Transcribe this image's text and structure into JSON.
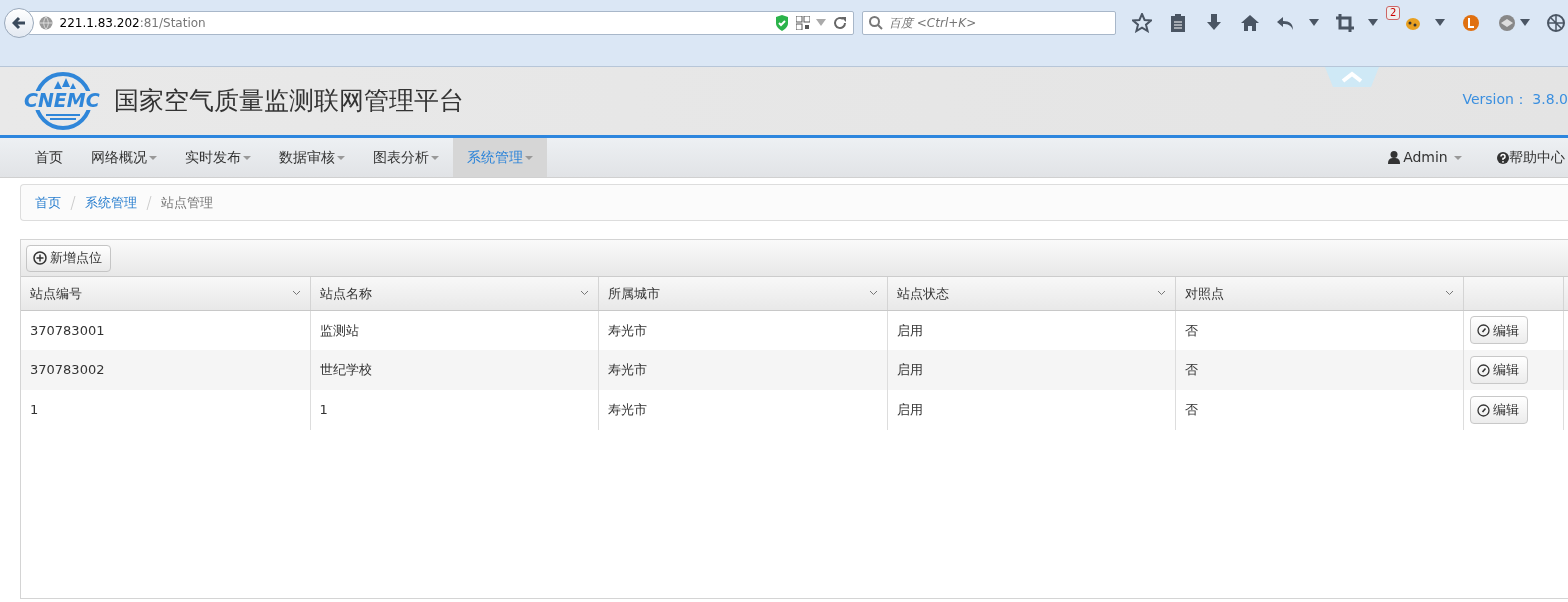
{
  "browser": {
    "url_host": "221.1.83.202",
    "url_rest": ":81/Station",
    "search": {
      "placeholder": "百度 <Ctrl+K>"
    },
    "badge": "2"
  },
  "header": {
    "logo_text": "CNEMC",
    "title": "国家空气质量监测联网管理平台",
    "version": "Version： 3.8.0"
  },
  "nav": {
    "items": [
      {
        "label": "首页",
        "dropdown": false,
        "selected": false
      },
      {
        "label": "网络概况",
        "dropdown": true,
        "selected": false
      },
      {
        "label": "实时发布",
        "dropdown": true,
        "selected": false
      },
      {
        "label": "数据审核",
        "dropdown": true,
        "selected": false
      },
      {
        "label": "图表分析",
        "dropdown": true,
        "selected": false
      },
      {
        "label": "系统管理",
        "dropdown": true,
        "selected": true
      }
    ],
    "user": "Admin",
    "help": "帮助中心"
  },
  "breadcrumb": [
    {
      "label": "首页",
      "link": true
    },
    {
      "label": "系统管理",
      "link": true
    },
    {
      "label": "站点管理",
      "link": false
    }
  ],
  "toolbar": {
    "add_button": "新增点位"
  },
  "table": {
    "columns": [
      "站点编号",
      "站点名称",
      "所属城市",
      "站点状态",
      "对照点"
    ],
    "rows": [
      {
        "cells": [
          "370783001",
          "监测站",
          "寿光市",
          "启用",
          "否"
        ],
        "action": "编辑"
      },
      {
        "cells": [
          "370783002",
          "世纪学校",
          "寿光市",
          "启用",
          "否"
        ],
        "action": "编辑"
      },
      {
        "cells": [
          "1",
          "1",
          "寿光市",
          "启用",
          "否"
        ],
        "action": "编辑"
      }
    ]
  }
}
